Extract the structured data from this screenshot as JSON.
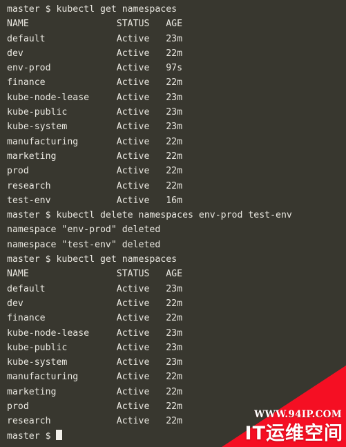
{
  "terminal": {
    "background_color": "#38372f",
    "text_color": "#e9e7e0",
    "prompt": "master $ ",
    "cursor_visible": true,
    "lines": [
      "master $ kubectl get namespaces",
      "NAME                STATUS   AGE",
      "default             Active   23m",
      "dev                 Active   22m",
      "env-prod            Active   97s",
      "finance             Active   22m",
      "kube-node-lease     Active   23m",
      "kube-public         Active   23m",
      "kube-system         Active   23m",
      "manufacturing       Active   22m",
      "marketing           Active   22m",
      "prod                Active   22m",
      "research            Active   22m",
      "test-env            Active   16m",
      "master $ kubectl delete namespaces env-prod test-env",
      "namespace \"env-prod\" deleted",
      "namespace \"test-env\" deleted",
      "master $ kubectl get namespaces",
      "NAME                STATUS   AGE",
      "default             Active   23m",
      "dev                 Active   22m",
      "finance             Active   22m",
      "kube-node-lease     Active   23m",
      "kube-public         Active   23m",
      "kube-system         Active   23m",
      "manufacturing       Active   22m",
      "marketing           Active   22m",
      "prod                Active   22m",
      "research            Active   22m"
    ],
    "final_prompt": "master $ ",
    "commands": [
      "kubectl get namespaces",
      "kubectl delete namespaces env-prod test-env",
      "kubectl get namespaces"
    ],
    "table_headers": [
      "NAME",
      "STATUS",
      "AGE"
    ],
    "namespaces_before": [
      {
        "name": "default",
        "status": "Active",
        "age": "23m"
      },
      {
        "name": "dev",
        "status": "Active",
        "age": "22m"
      },
      {
        "name": "env-prod",
        "status": "Active",
        "age": "97s"
      },
      {
        "name": "finance",
        "status": "Active",
        "age": "22m"
      },
      {
        "name": "kube-node-lease",
        "status": "Active",
        "age": "23m"
      },
      {
        "name": "kube-public",
        "status": "Active",
        "age": "23m"
      },
      {
        "name": "kube-system",
        "status": "Active",
        "age": "23m"
      },
      {
        "name": "manufacturing",
        "status": "Active",
        "age": "22m"
      },
      {
        "name": "marketing",
        "status": "Active",
        "age": "22m"
      },
      {
        "name": "prod",
        "status": "Active",
        "age": "22m"
      },
      {
        "name": "research",
        "status": "Active",
        "age": "22m"
      },
      {
        "name": "test-env",
        "status": "Active",
        "age": "16m"
      }
    ],
    "delete_messages": [
      "namespace \"env-prod\" deleted",
      "namespace \"test-env\" deleted"
    ],
    "namespaces_after": [
      {
        "name": "default",
        "status": "Active",
        "age": "23m"
      },
      {
        "name": "dev",
        "status": "Active",
        "age": "22m"
      },
      {
        "name": "finance",
        "status": "Active",
        "age": "22m"
      },
      {
        "name": "kube-node-lease",
        "status": "Active",
        "age": "23m"
      },
      {
        "name": "kube-public",
        "status": "Active",
        "age": "23m"
      },
      {
        "name": "kube-system",
        "status": "Active",
        "age": "23m"
      },
      {
        "name": "manufacturing",
        "status": "Active",
        "age": "22m"
      },
      {
        "name": "marketing",
        "status": "Active",
        "age": "22m"
      },
      {
        "name": "prod",
        "status": "Active",
        "age": "22m"
      },
      {
        "name": "research",
        "status": "Active",
        "age": "22m"
      }
    ]
  },
  "watermark": {
    "url": "WWW.94IP.COM",
    "brand": "IT运维空间",
    "color": "#f50f23",
    "text_color": "#ffffff"
  }
}
